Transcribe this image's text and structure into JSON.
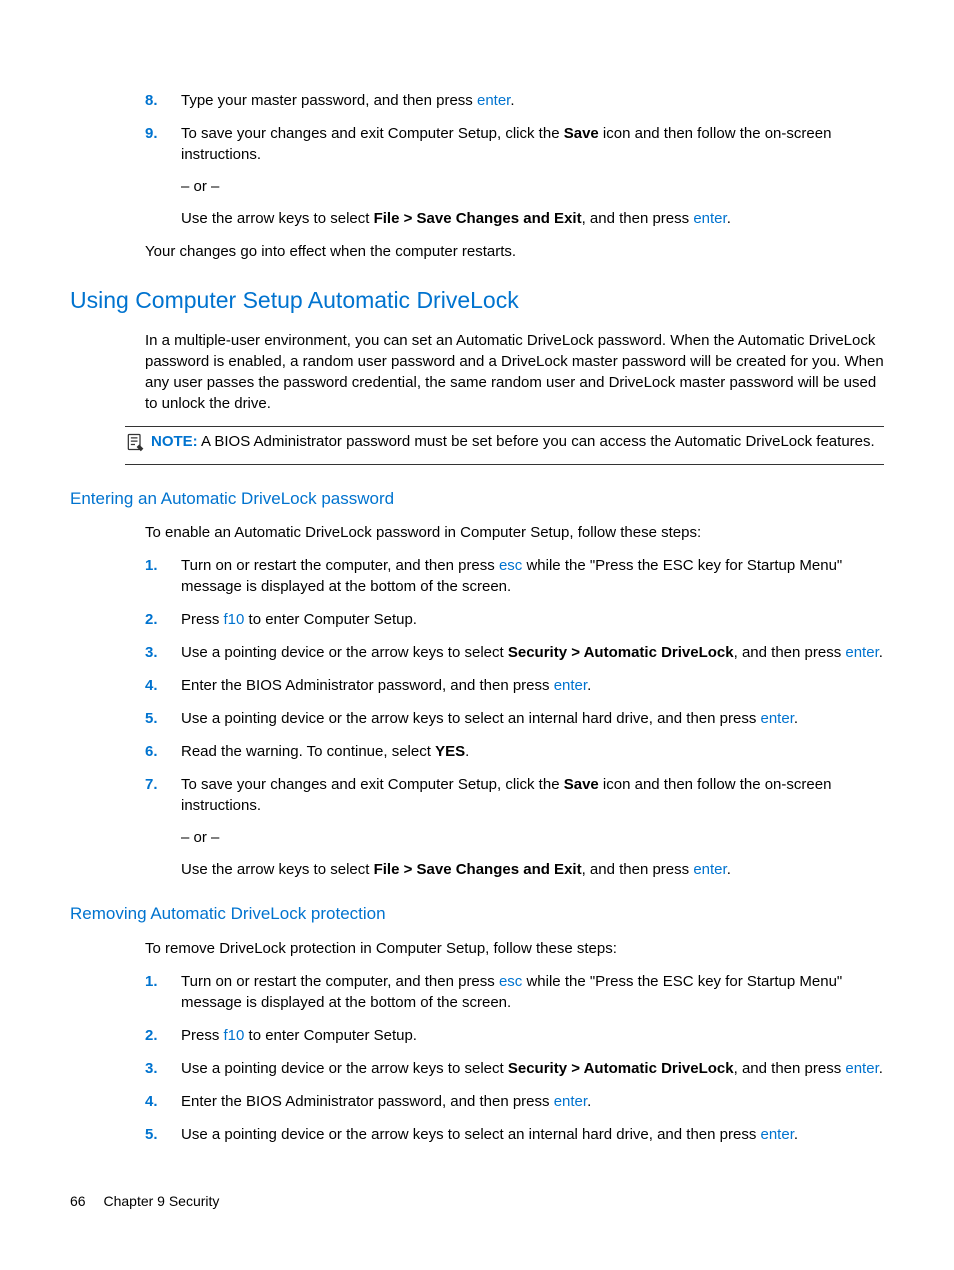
{
  "list1": {
    "start": 8,
    "items": [
      {
        "num": "8.",
        "parts": [
          {
            "t": "Type your master password, and then press "
          },
          {
            "t": "enter",
            "key": true
          },
          {
            "t": "."
          }
        ]
      },
      {
        "num": "9.",
        "parts": [
          {
            "t": "To save your changes and exit Computer Setup, click the "
          },
          {
            "t": "Save",
            "bold": true
          },
          {
            "t": " icon and then follow the on-screen instructions."
          }
        ],
        "subs": [
          {
            "parts": [
              {
                "t": "– or –"
              }
            ]
          },
          {
            "parts": [
              {
                "t": "Use the arrow keys to select "
              },
              {
                "t": "File > Save Changes and Exit",
                "bold": true
              },
              {
                "t": ", and then press "
              },
              {
                "t": "enter",
                "key": true
              },
              {
                "t": "."
              }
            ]
          }
        ]
      }
    ]
  },
  "after_list1": {
    "parts": [
      {
        "t": "Your changes go into effect when the computer restarts."
      }
    ]
  },
  "h2_1": "Using Computer Setup Automatic DriveLock",
  "para_h2_1": {
    "parts": [
      {
        "t": "In a multiple-user environment, you can set an Automatic DriveLock password. When the Automatic DriveLock password is enabled, a random user password and a DriveLock master password will be created for you. When any user passes the password credential, the same random user and DriveLock master password will be used to unlock the drive."
      }
    ]
  },
  "note": {
    "label": "NOTE:",
    "parts": [
      {
        "t": "A BIOS Administrator password must be set before you can access the Automatic DriveLock features."
      }
    ]
  },
  "h3_1": "Entering an Automatic DriveLock password",
  "para_h3_1": {
    "parts": [
      {
        "t": "To enable an Automatic DriveLock password in Computer Setup, follow these steps:"
      }
    ]
  },
  "list2": {
    "items": [
      {
        "num": "1.",
        "parts": [
          {
            "t": "Turn on or restart the computer, and then press "
          },
          {
            "t": "esc",
            "key": true
          },
          {
            "t": " while the \"Press the ESC key for Startup Menu\" message is displayed at the bottom of the screen."
          }
        ]
      },
      {
        "num": "2.",
        "parts": [
          {
            "t": "Press "
          },
          {
            "t": "f10",
            "key": true
          },
          {
            "t": " to enter Computer Setup."
          }
        ]
      },
      {
        "num": "3.",
        "parts": [
          {
            "t": "Use a pointing device or the arrow keys to select "
          },
          {
            "t": "Security > Automatic DriveLock",
            "bold": true
          },
          {
            "t": ", and then press "
          },
          {
            "t": "enter",
            "key": true
          },
          {
            "t": "."
          }
        ]
      },
      {
        "num": "4.",
        "parts": [
          {
            "t": "Enter the BIOS Administrator password, and then press "
          },
          {
            "t": "enter",
            "key": true
          },
          {
            "t": "."
          }
        ]
      },
      {
        "num": "5.",
        "parts": [
          {
            "t": "Use a pointing device or the arrow keys to select an internal hard drive, and then press "
          },
          {
            "t": "enter",
            "key": true
          },
          {
            "t": "."
          }
        ]
      },
      {
        "num": "6.",
        "parts": [
          {
            "t": "Read the warning. To continue, select "
          },
          {
            "t": "YES",
            "bold": true
          },
          {
            "t": "."
          }
        ]
      },
      {
        "num": "7.",
        "parts": [
          {
            "t": "To save your changes and exit Computer Setup, click the "
          },
          {
            "t": "Save",
            "bold": true
          },
          {
            "t": " icon and then follow the on-screen instructions."
          }
        ],
        "subs": [
          {
            "parts": [
              {
                "t": "– or –"
              }
            ]
          },
          {
            "parts": [
              {
                "t": "Use the arrow keys to select "
              },
              {
                "t": "File > Save Changes and Exit",
                "bold": true
              },
              {
                "t": ", and then press "
              },
              {
                "t": "enter",
                "key": true
              },
              {
                "t": "."
              }
            ]
          }
        ]
      }
    ]
  },
  "h3_2": "Removing Automatic DriveLock protection",
  "para_h3_2": {
    "parts": [
      {
        "t": "To remove DriveLock protection in Computer Setup, follow these steps:"
      }
    ]
  },
  "list3": {
    "items": [
      {
        "num": "1.",
        "parts": [
          {
            "t": "Turn on or restart the computer, and then press "
          },
          {
            "t": "esc",
            "key": true
          },
          {
            "t": " while the \"Press the ESC key for Startup Menu\" message is displayed at the bottom of the screen."
          }
        ]
      },
      {
        "num": "2.",
        "parts": [
          {
            "t": "Press "
          },
          {
            "t": "f10",
            "key": true
          },
          {
            "t": " to enter Computer Setup."
          }
        ]
      },
      {
        "num": "3.",
        "parts": [
          {
            "t": "Use a pointing device or the arrow keys to select "
          },
          {
            "t": "Security > Automatic DriveLock",
            "bold": true
          },
          {
            "t": ", and then press "
          },
          {
            "t": "enter",
            "key": true
          },
          {
            "t": "."
          }
        ]
      },
      {
        "num": "4.",
        "parts": [
          {
            "t": "Enter the BIOS Administrator password, and then press "
          },
          {
            "t": "enter",
            "key": true
          },
          {
            "t": "."
          }
        ]
      },
      {
        "num": "5.",
        "parts": [
          {
            "t": "Use a pointing device or the arrow keys to select an internal hard drive, and then press "
          },
          {
            "t": "enter",
            "key": true
          },
          {
            "t": "."
          }
        ]
      }
    ]
  },
  "footer": {
    "page": "66",
    "chapter": "Chapter 9   Security"
  }
}
